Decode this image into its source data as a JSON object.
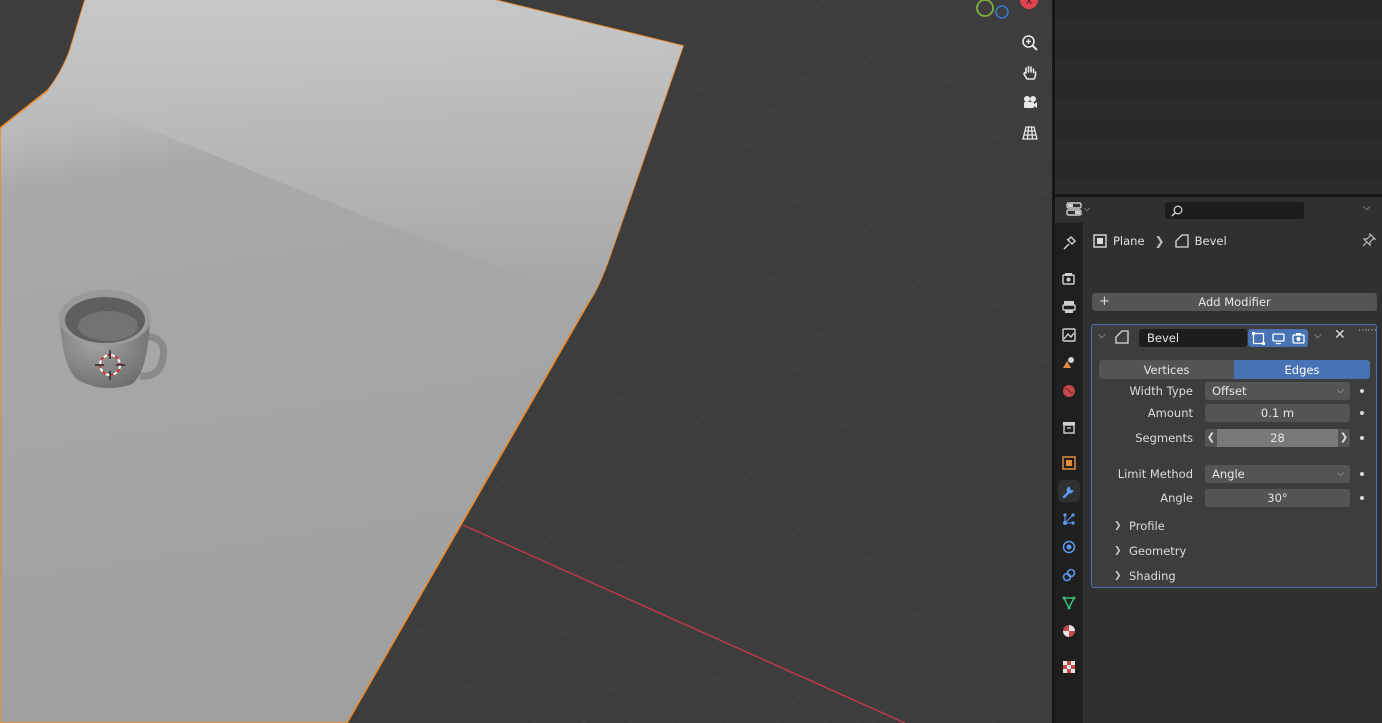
{
  "viewport": {
    "nav_icons": [
      "zoom-icon",
      "pan-hand-icon",
      "camera-icon",
      "perspective-grid-icon"
    ],
    "colors": {
      "selection_outline": "#f08a24",
      "x_axis": "#c2384a",
      "grid": "#474747"
    }
  },
  "properties": {
    "search_placeholder": "",
    "breadcrumb": {
      "object": "Plane",
      "modifier": "Bevel"
    },
    "add_modifier_label": "Add Modifier",
    "tabs": [
      "tool-icon",
      "render-icon",
      "output-icon",
      "view-layer-icon",
      "scene-icon",
      "world-icon",
      "collection-icon",
      "object-icon",
      "modifier-icon",
      "particles-icon",
      "physics-icon",
      "constraints-icon",
      "data-icon",
      "material-icon",
      "texture-icon"
    ],
    "active_tab": "modifier-icon",
    "modifier": {
      "name": "Bevel",
      "affect_options": [
        "Vertices",
        "Edges"
      ],
      "affect_selected": "Edges",
      "width_type_label": "Width Type",
      "width_type_value": "Offset",
      "amount_label": "Amount",
      "amount_value": "0.1 m",
      "segments_label": "Segments",
      "segments_value": "28",
      "limit_method_label": "Limit Method",
      "limit_method_value": "Angle",
      "angle_label": "Angle",
      "angle_value": "30°",
      "subpanels": [
        "Profile",
        "Geometry",
        "Shading"
      ]
    },
    "colors": {
      "accent": "#4772b3",
      "field": "#545454"
    }
  }
}
